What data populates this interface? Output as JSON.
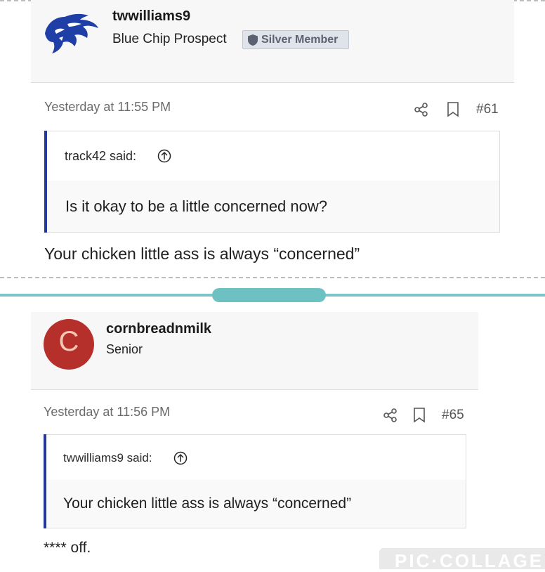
{
  "post1": {
    "username": "twwilliams9",
    "user_title": "Blue Chip Prospect",
    "badge": "Silver Member",
    "timestamp": "Yesterday at 11:55 PM",
    "post_number": "#61",
    "quote_author": "track42 said:",
    "quote_text": "Is it okay to be a little concerned now?",
    "body": "Your chicken little ass is always “concerned”"
  },
  "post2": {
    "avatar_letter": "C",
    "username": "cornbreadnmilk",
    "user_title": "Senior",
    "timestamp": "Yesterday at 11:56 PM",
    "post_number": "#65",
    "quote_author": "twwilliams9 said:",
    "quote_text": "Your chicken little ass is always “concerned”",
    "body": "**** off."
  },
  "watermark": "PIC·COLLAGE",
  "colors": {
    "quote_bar": "#23389b",
    "avatar_bg": "#b5302a",
    "divider": "#7cc4c5",
    "wildcat_logo": "#1f3fa6"
  },
  "icons": [
    "wildcat-logo",
    "shield-icon",
    "share-icon",
    "bookmark-icon",
    "arrow-up-circle-icon"
  ]
}
